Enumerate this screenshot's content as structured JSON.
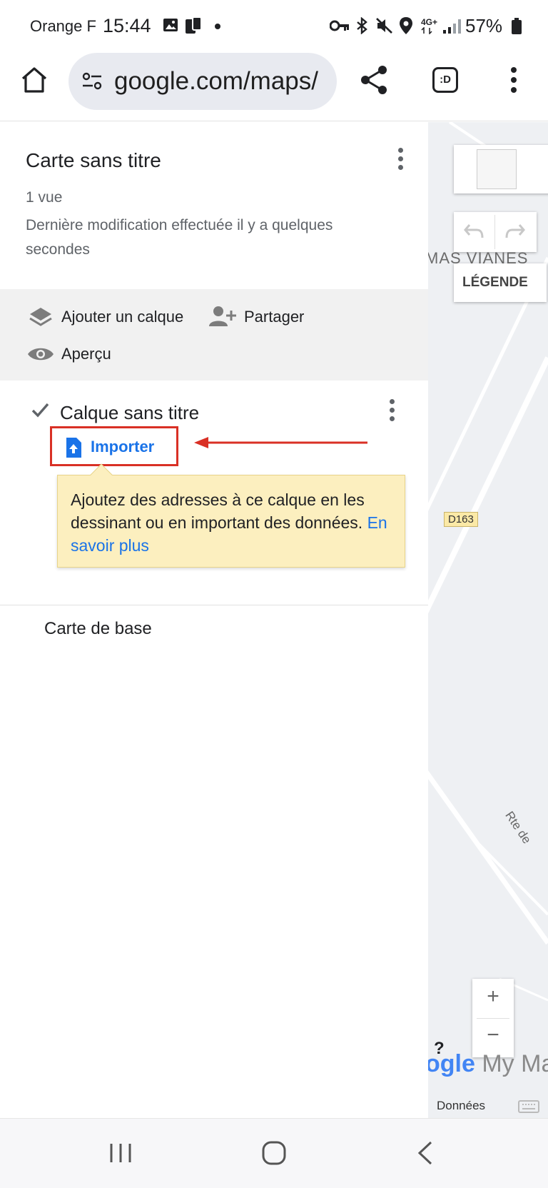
{
  "status_bar": {
    "carrier": "Orange F",
    "time": "15:44",
    "network": "4G+",
    "battery": "57%"
  },
  "browser": {
    "url": "google.com/maps/",
    "tab_label": ":D"
  },
  "panel": {
    "map_title": "Carte sans titre",
    "views": "1 vue",
    "last_modified": "Dernière modification effectuée il y a quelques secondes",
    "actions": {
      "add_layer": "Ajouter un calque",
      "share": "Partager",
      "preview": "Aperçu"
    },
    "layer": {
      "title": "Calque sans titre",
      "checked": true,
      "import_label": "Importer"
    },
    "tooltip": {
      "text": "Ajoutez des adresses à ce calque en les dessinant ou en important des données.",
      "link": "En savoir plus"
    },
    "base_map": "Carte de base"
  },
  "map": {
    "place_label": "MAS VIANES",
    "road_shield": "D163",
    "road_label": "Rte de",
    "legend_button": "LÉGENDE",
    "zoom_in": "+",
    "zoom_out": "−",
    "help": "?",
    "logo_google": "ogle",
    "logo_suffix": "My Ma",
    "data_label": "Données"
  },
  "colors": {
    "link_blue": "#1a73e8",
    "highlight_red": "#d93025",
    "tooltip_bg": "#fcefbf"
  }
}
